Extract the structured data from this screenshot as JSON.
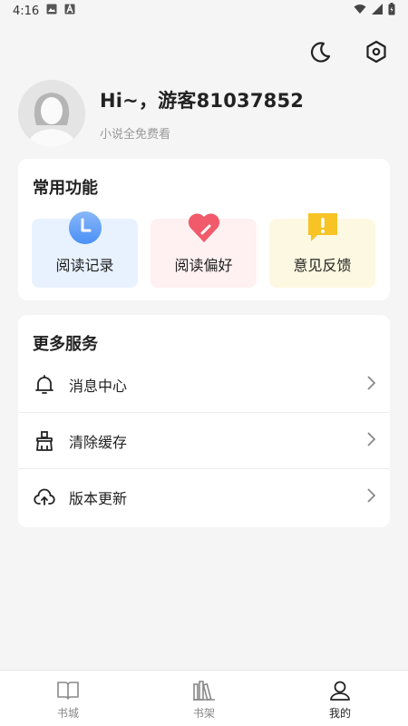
{
  "status_bar": {
    "time": "4:16",
    "icons": [
      "image-icon",
      "a-icon",
      "wifi-icon",
      "signal-icon",
      "battery-icon"
    ]
  },
  "top_actions": {
    "icons": [
      "moon-icon",
      "settings-icon"
    ]
  },
  "profile": {
    "greeting": "Hi~，游客81037852",
    "subtitle": "小说全免费看",
    "avatar_icon": "default-avatar"
  },
  "common_functions": {
    "title": "常用功能",
    "items": [
      {
        "label": "阅读记录",
        "icon": "clock-icon",
        "color": "#4a90f5",
        "bg": "#e8f2ff"
      },
      {
        "label": "阅读偏好",
        "icon": "heart-icon",
        "color": "#f05a6a",
        "bg": "#fff0f1"
      },
      {
        "label": "意见反馈",
        "icon": "alert-bubble-icon",
        "color": "#f7c325",
        "bg": "#fdf8e1"
      }
    ]
  },
  "more_services": {
    "title": "更多服务",
    "items": [
      {
        "label": "消息中心",
        "icon": "bell-icon"
      },
      {
        "label": "清除缓存",
        "icon": "broom-icon"
      },
      {
        "label": "版本更新",
        "icon": "upload-cloud-icon"
      }
    ]
  },
  "tabbar": {
    "tabs": [
      {
        "label": "书城",
        "icon": "book-icon",
        "active": false
      },
      {
        "label": "书架",
        "icon": "bookshelf-icon",
        "active": false
      },
      {
        "label": "我的",
        "icon": "user-icon",
        "active": true
      }
    ]
  }
}
